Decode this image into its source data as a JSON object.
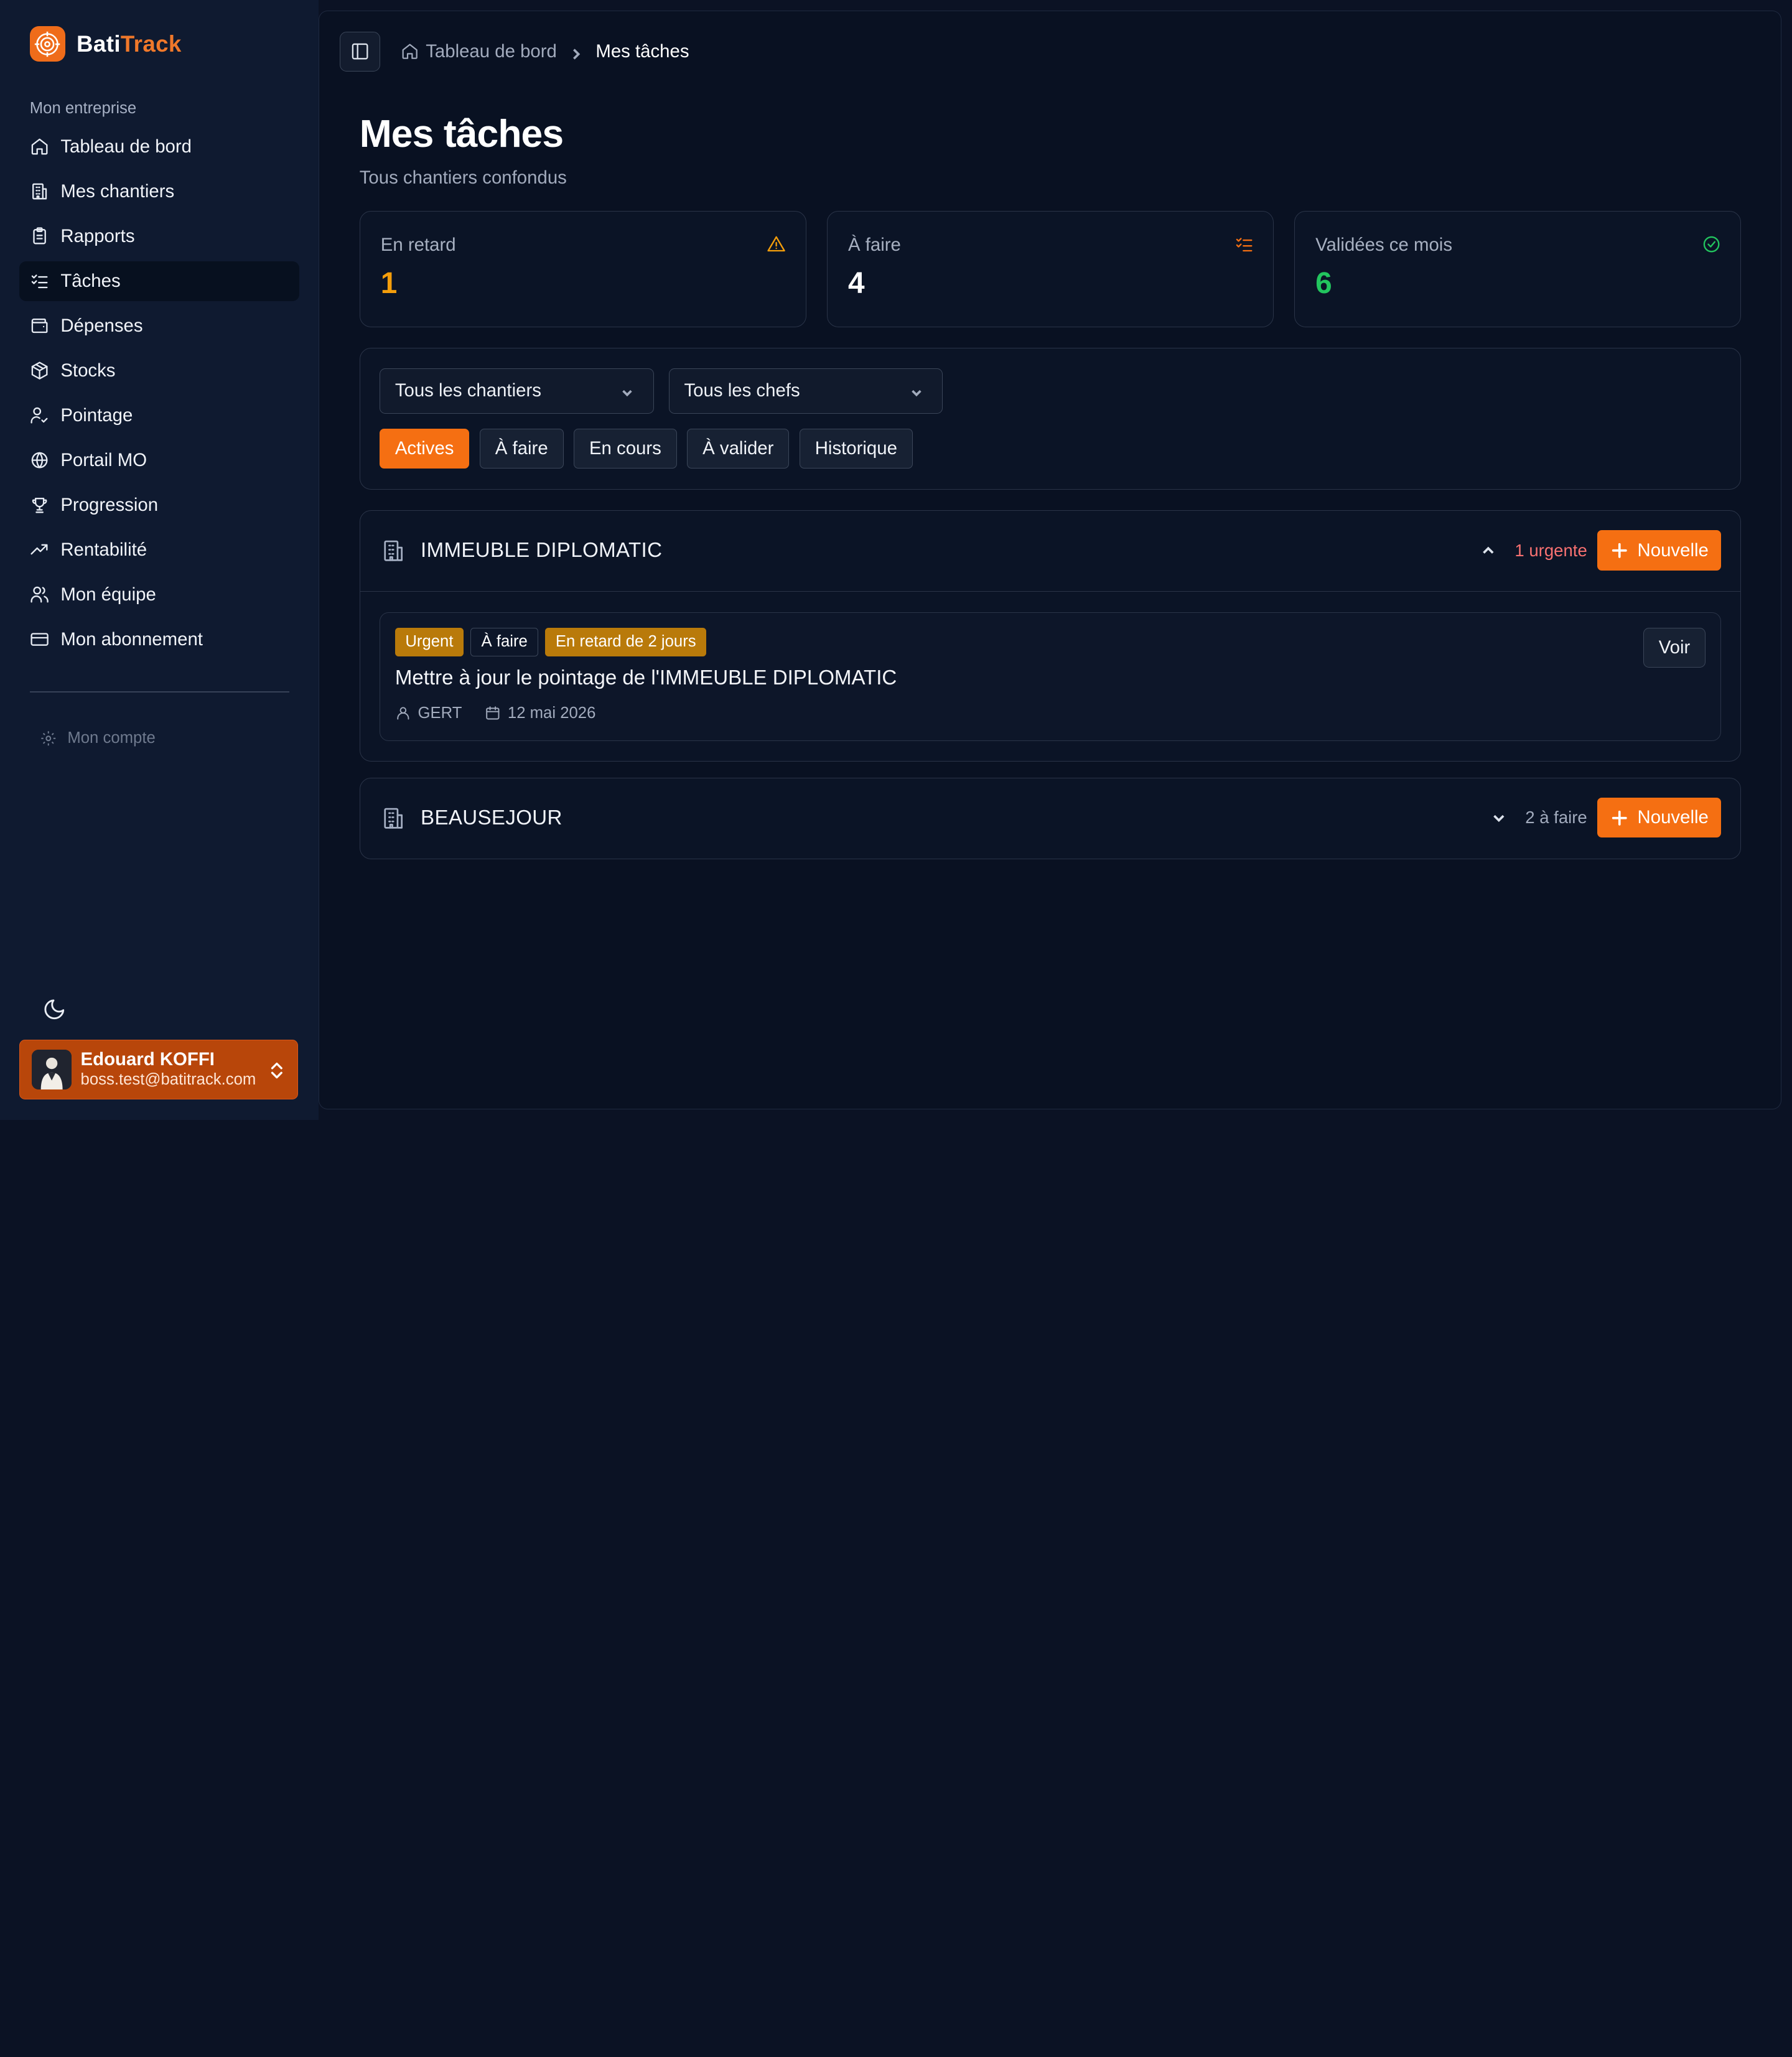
{
  "brand": {
    "part1": "Bati",
    "part2": "Track"
  },
  "sidebar": {
    "section_label": "Mon entreprise",
    "items": [
      {
        "label": "Tableau de bord",
        "icon": "home-icon"
      },
      {
        "label": "Mes chantiers",
        "icon": "building-icon"
      },
      {
        "label": "Rapports",
        "icon": "clipboard-icon"
      },
      {
        "label": "Tâches",
        "icon": "list-checks-icon",
        "active": true
      },
      {
        "label": "Dépenses",
        "icon": "wallet-icon"
      },
      {
        "label": "Stocks",
        "icon": "package-icon"
      },
      {
        "label": "Pointage",
        "icon": "user-check-icon"
      },
      {
        "label": "Portail MO",
        "icon": "globe-icon"
      },
      {
        "label": "Progression",
        "icon": "trophy-icon"
      },
      {
        "label": "Rentabilité",
        "icon": "trending-up-icon"
      },
      {
        "label": "Mon équipe",
        "icon": "users-icon"
      },
      {
        "label": "Mon abonnement",
        "icon": "credit-card-icon"
      }
    ],
    "account_label": "Mon compte",
    "user": {
      "name": "Edouard KOFFI",
      "email": "boss.test@batitrack.com"
    }
  },
  "breadcrumb": {
    "home": "Tableau de bord",
    "current": "Mes tâches"
  },
  "page": {
    "title": "Mes tâches",
    "subtitle": "Tous chantiers confondus"
  },
  "stats": [
    {
      "label": "En retard",
      "value": "1",
      "color": "#f59e0b",
      "icon": "alert-triangle-icon"
    },
    {
      "label": "À faire",
      "value": "4",
      "color": "#ffffff",
      "icon": "list-todo-icon"
    },
    {
      "label": "Validées ce mois",
      "value": "6",
      "color": "#22c55e",
      "icon": "check-circle-icon"
    }
  ],
  "filters": {
    "chantier_select": "Tous les chantiers",
    "chef_select": "Tous les chefs",
    "chips": [
      "Actives",
      "À faire",
      "En cours",
      "À valider",
      "Historique"
    ],
    "active_chip": "Actives"
  },
  "groups": [
    {
      "name": "IMMEUBLE DIPLOMATIC",
      "count_label": "1 urgente",
      "count_color": "#f87171",
      "expanded": true,
      "new_label": "Nouvelle",
      "tasks": [
        {
          "badges": [
            "Urgent",
            "À faire",
            "En retard de 2 jours"
          ],
          "title": "Mettre à jour le pointage de l'IMMEUBLE DIPLOMATIC",
          "assignee": "GERT",
          "date": "12 mai 2026",
          "action": "Voir"
        }
      ]
    },
    {
      "name": "BEAUSEJOUR",
      "count_label": "2 à faire",
      "count_color": "#a2abbd",
      "expanded": false,
      "new_label": "Nouvelle"
    }
  ],
  "colors": {
    "accent": "#f56f12",
    "background": "#091122",
    "sidebar": "#0f1a30"
  }
}
